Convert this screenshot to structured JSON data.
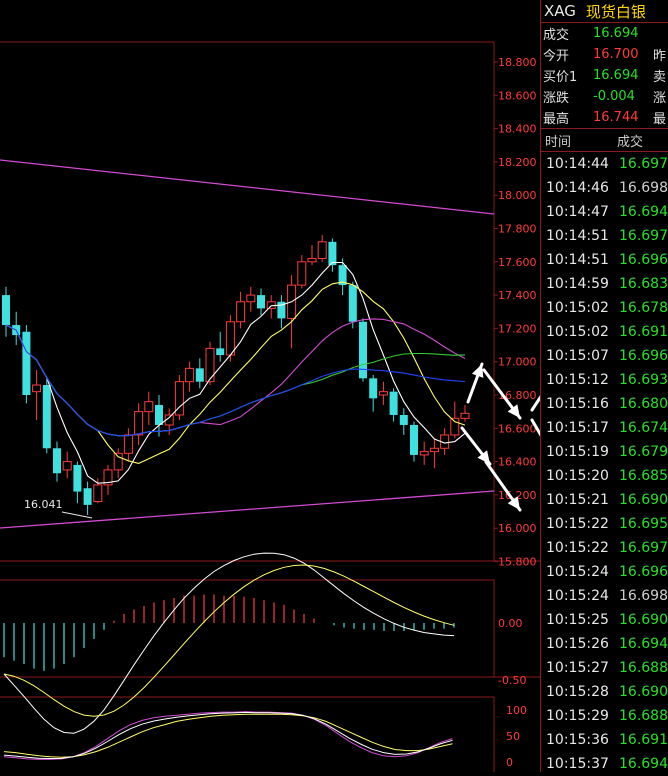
{
  "header": {
    "symbol": "XAG",
    "name": "现货白银"
  },
  "quote": [
    {
      "label": "成交",
      "value": "16.694",
      "color": "green",
      "label2": ""
    },
    {
      "label": "今开",
      "value": "16.700",
      "color": "red",
      "label2": "昨"
    },
    {
      "label": "买价1",
      "value": "16.694",
      "color": "green",
      "label2": "卖"
    },
    {
      "label": "涨跌",
      "value": "-0.004",
      "color": "green",
      "label2": "涨"
    },
    {
      "label": "最高",
      "value": "16.744",
      "color": "red",
      "label2": "最"
    }
  ],
  "ticks_header": {
    "time": "时间",
    "price": "成交"
  },
  "ticks": [
    {
      "time": "10:14:44",
      "price": "16.697",
      "color": "green"
    },
    {
      "time": "10:14:46",
      "price": "16.698",
      "color": "white"
    },
    {
      "time": "10:14:47",
      "price": "16.694",
      "color": "green"
    },
    {
      "time": "10:14:51",
      "price": "16.697",
      "color": "green"
    },
    {
      "time": "10:14:51",
      "price": "16.696",
      "color": "green"
    },
    {
      "time": "10:14:59",
      "price": "16.683",
      "color": "green"
    },
    {
      "time": "10:15:02",
      "price": "16.678",
      "color": "green"
    },
    {
      "time": "10:15:02",
      "price": "16.691",
      "color": "green"
    },
    {
      "time": "10:15:07",
      "price": "16.696",
      "color": "green"
    },
    {
      "time": "10:15:12",
      "price": "16.693",
      "color": "green"
    },
    {
      "time": "10:15:16",
      "price": "16.680",
      "color": "green"
    },
    {
      "time": "10:15:17",
      "price": "16.674",
      "color": "green"
    },
    {
      "time": "10:15:19",
      "price": "16.679",
      "color": "green"
    },
    {
      "time": "10:15:20",
      "price": "16.685",
      "color": "green"
    },
    {
      "time": "10:15:21",
      "price": "16.690",
      "color": "green"
    },
    {
      "time": "10:15:22",
      "price": "16.695",
      "color": "green"
    },
    {
      "time": "10:15:22",
      "price": "16.697",
      "color": "green"
    },
    {
      "time": "10:15:24",
      "price": "16.696",
      "color": "green"
    },
    {
      "time": "10:15:24",
      "price": "16.698",
      "color": "white"
    },
    {
      "time": "10:15:25",
      "price": "16.690",
      "color": "green"
    },
    {
      "time": "10:15:26",
      "price": "16.694",
      "color": "green"
    },
    {
      "time": "10:15:27",
      "price": "16.688",
      "color": "green"
    },
    {
      "time": "10:15:28",
      "price": "16.690",
      "color": "green"
    },
    {
      "time": "10:15:29",
      "price": "16.688",
      "color": "green"
    },
    {
      "time": "10:15:36",
      "price": "16.691",
      "color": "green"
    },
    {
      "time": "10:15:37",
      "price": "16.694",
      "color": "green"
    }
  ],
  "chart_data": {
    "type": "candlestick",
    "low_label": "16.041",
    "price_axis": [
      "18.800",
      "18.600",
      "18.400",
      "18.200",
      "18.000",
      "17.800",
      "17.600",
      "17.400",
      "17.200",
      "17.000",
      "16.800",
      "16.600",
      "16.400",
      "16.200",
      "16.000",
      "15.800"
    ],
    "macd_axis": [
      "0.00",
      "-0.50"
    ],
    "kdj_axis": [
      "100",
      "50",
      "0"
    ],
    "candles": [
      {
        "o": 17.4,
        "h": 17.45,
        "l": 17.15,
        "c": 17.22
      },
      {
        "o": 17.22,
        "h": 17.3,
        "l": 17.1,
        "c": 17.16
      },
      {
        "o": 17.18,
        "h": 17.22,
        "l": 16.75,
        "c": 16.8
      },
      {
        "o": 16.82,
        "h": 16.95,
        "l": 16.65,
        "c": 16.86
      },
      {
        "o": 16.86,
        "h": 16.9,
        "l": 16.45,
        "c": 16.48
      },
      {
        "o": 16.48,
        "h": 16.52,
        "l": 16.28,
        "c": 16.33
      },
      {
        "o": 16.35,
        "h": 16.46,
        "l": 16.3,
        "c": 16.4
      },
      {
        "o": 16.38,
        "h": 16.4,
        "l": 16.15,
        "c": 16.22
      },
      {
        "o": 16.24,
        "h": 16.28,
        "l": 16.08,
        "c": 16.14
      },
      {
        "o": 16.16,
        "h": 16.3,
        "l": 16.15,
        "c": 16.26
      },
      {
        "o": 16.26,
        "h": 16.38,
        "l": 16.2,
        "c": 16.35
      },
      {
        "o": 16.35,
        "h": 16.48,
        "l": 16.3,
        "c": 16.45
      },
      {
        "o": 16.45,
        "h": 16.6,
        "l": 16.4,
        "c": 16.56
      },
      {
        "o": 16.56,
        "h": 16.75,
        "l": 16.5,
        "c": 16.7
      },
      {
        "o": 16.7,
        "h": 16.82,
        "l": 16.62,
        "c": 16.76
      },
      {
        "o": 16.74,
        "h": 16.8,
        "l": 16.55,
        "c": 16.62
      },
      {
        "o": 16.62,
        "h": 16.72,
        "l": 16.56,
        "c": 16.68
      },
      {
        "o": 16.68,
        "h": 16.92,
        "l": 16.65,
        "c": 16.88
      },
      {
        "o": 16.88,
        "h": 17.0,
        "l": 16.82,
        "c": 16.96
      },
      {
        "o": 16.96,
        "h": 17.02,
        "l": 16.84,
        "c": 16.88
      },
      {
        "o": 16.88,
        "h": 17.12,
        "l": 16.86,
        "c": 17.08
      },
      {
        "o": 17.08,
        "h": 17.18,
        "l": 17.0,
        "c": 17.04
      },
      {
        "o": 17.04,
        "h": 17.28,
        "l": 17.0,
        "c": 17.24
      },
      {
        "o": 17.24,
        "h": 17.42,
        "l": 17.2,
        "c": 17.36
      },
      {
        "o": 17.36,
        "h": 17.45,
        "l": 17.3,
        "c": 17.4
      },
      {
        "o": 17.4,
        "h": 17.44,
        "l": 17.28,
        "c": 17.32
      },
      {
        "o": 17.32,
        "h": 17.4,
        "l": 17.26,
        "c": 17.36
      },
      {
        "o": 17.36,
        "h": 17.4,
        "l": 17.2,
        "c": 17.26
      },
      {
        "o": 17.26,
        "h": 17.52,
        "l": 17.08,
        "c": 17.46
      },
      {
        "o": 17.46,
        "h": 17.64,
        "l": 17.44,
        "c": 17.6
      },
      {
        "o": 17.6,
        "h": 17.7,
        "l": 17.58,
        "c": 17.62
      },
      {
        "o": 17.62,
        "h": 17.76,
        "l": 17.6,
        "c": 17.72
      },
      {
        "o": 17.72,
        "h": 17.74,
        "l": 17.54,
        "c": 17.58
      },
      {
        "o": 17.58,
        "h": 17.62,
        "l": 17.4,
        "c": 17.46
      },
      {
        "o": 17.46,
        "h": 17.48,
        "l": 17.2,
        "c": 17.24
      },
      {
        "o": 17.24,
        "h": 17.26,
        "l": 16.88,
        "c": 16.9
      },
      {
        "o": 16.9,
        "h": 16.92,
        "l": 16.7,
        "c": 16.78
      },
      {
        "o": 16.8,
        "h": 16.88,
        "l": 16.74,
        "c": 16.82
      },
      {
        "o": 16.82,
        "h": 16.84,
        "l": 16.64,
        "c": 16.68
      },
      {
        "o": 16.68,
        "h": 16.72,
        "l": 16.56,
        "c": 16.62
      },
      {
        "o": 16.62,
        "h": 16.64,
        "l": 16.4,
        "c": 16.44
      },
      {
        "o": 16.44,
        "h": 16.52,
        "l": 16.38,
        "c": 16.46
      },
      {
        "o": 16.46,
        "h": 16.54,
        "l": 16.36,
        "c": 16.48
      },
      {
        "o": 16.48,
        "h": 16.6,
        "l": 16.44,
        "c": 16.56
      },
      {
        "o": 16.56,
        "h": 16.76,
        "l": 16.54,
        "c": 16.66
      },
      {
        "o": 16.66,
        "h": 16.74,
        "l": 16.64,
        "c": 16.69
      }
    ],
    "macd_hist": [
      -0.3,
      -0.33,
      -0.36,
      -0.4,
      -0.42,
      -0.4,
      -0.36,
      -0.3,
      -0.22,
      -0.14,
      -0.06,
      0.02,
      0.08,
      0.12,
      0.15,
      0.18,
      0.2,
      0.22,
      0.24,
      0.24,
      0.25,
      0.25,
      0.24,
      0.24,
      0.23,
      0.22,
      0.2,
      0.18,
      0.16,
      0.12,
      0.08,
      0.04,
      0.0,
      -0.02,
      -0.04,
      -0.05,
      -0.06,
      -0.06,
      -0.07,
      -0.07,
      -0.07,
      -0.06,
      -0.06,
      -0.05,
      -0.05,
      -0.04
    ],
    "kdj_k": [
      10,
      8,
      6,
      5,
      5,
      6,
      10,
      18,
      30,
      45,
      60,
      72,
      80,
      85,
      88,
      90,
      92,
      94,
      95,
      96,
      96,
      97,
      96,
      96,
      95,
      94,
      90,
      82,
      70,
      55,
      40,
      28,
      18,
      12,
      10,
      12,
      18,
      28,
      38,
      45
    ],
    "kdj_d": [
      20,
      18,
      15,
      12,
      10,
      9,
      10,
      14,
      20,
      28,
      38,
      48,
      58,
      66,
      72,
      78,
      82,
      85,
      88,
      90,
      91,
      92,
      92,
      92,
      92,
      91,
      89,
      85,
      78,
      68,
      58,
      48,
      38,
      30,
      24,
      22,
      22,
      25,
      30,
      35
    ]
  }
}
